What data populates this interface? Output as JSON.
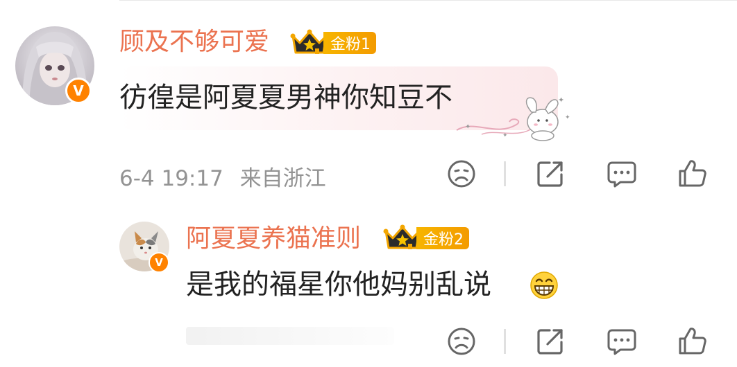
{
  "comment": {
    "username": "顾及不够可爱",
    "fan_badge": "金粉1",
    "text": "彷徨是阿夏夏男神你知豆不",
    "time": "6-4 19:17",
    "location": "来自浙江",
    "verified_mark": "V"
  },
  "reply": {
    "username": "阿夏夏养猫准则",
    "fan_badge": "金粉2",
    "text": "是我的福星你他妈别乱说",
    "emoji": "grinning-face-emoji",
    "verified_mark": "V"
  },
  "colors": {
    "username": "#eb7350",
    "verified": "#ff8200",
    "badge_gold": "#f7b500",
    "meta_gray": "#939393",
    "icon_gray": "#666666"
  },
  "icons": {
    "dislike": "frown-face-icon",
    "repost": "share-icon",
    "comment": "comment-icon",
    "like": "thumbs-up-icon"
  }
}
